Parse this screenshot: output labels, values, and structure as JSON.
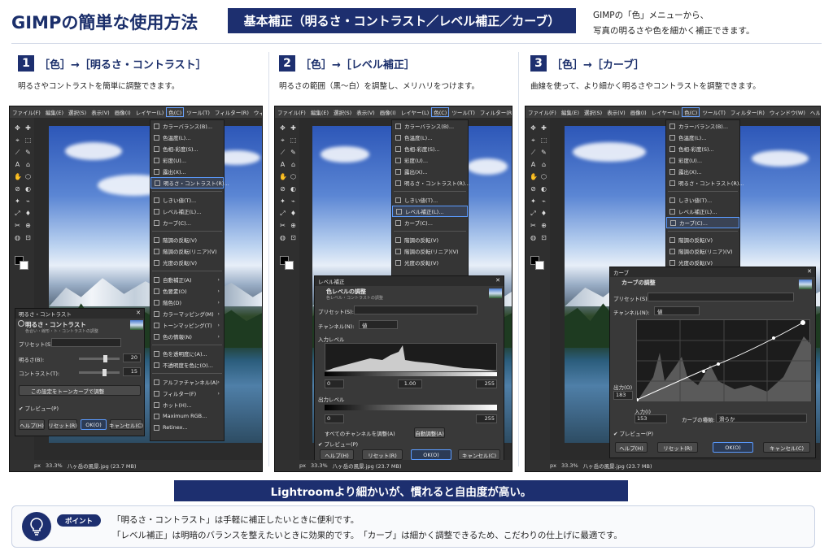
{
  "header": {
    "title": "GIMPの簡単な使用方法",
    "banner": "基本補正（明るさ・コントラスト／レベル補正／カーブ）",
    "lead_line1": "GIMPの「色」メニューから、",
    "lead_line2": "写真の明るさや色を細かく補正できます。"
  },
  "steps": [
    {
      "num": "1",
      "title": "［色］→［明るさ・コントラスト］",
      "desc": "明るさやコントラストを簡単に調整できます。"
    },
    {
      "num": "2",
      "title": "［色］→［レベル補正］",
      "desc": "明るさの範囲（黒〜白）を調整し、メリハリをつけます。"
    },
    {
      "num": "3",
      "title": "［色］→［カーブ］",
      "desc": "曲線を使って、より細かく明るさやコントラストを調整できます。"
    }
  ],
  "menubar": [
    "ファイル(F)",
    "編集(E)",
    "選択(S)",
    "表示(V)",
    "画像(I)",
    "レイヤー(L)",
    "色(C)",
    "ツール(T)",
    "フィルター(R)",
    "ウィンドウ(W)",
    "ヘルプ(H)"
  ],
  "color_menu_full": [
    {
      "label": "カラーバランス(B)..."
    },
    {
      "label": "色温度(L)..."
    },
    {
      "label": "色相-彩度(S)..."
    },
    {
      "label": "彩度(U)..."
    },
    {
      "label": "露出(X)..."
    },
    {
      "label": "明るさ・コントラスト(R)..."
    },
    {
      "sep": true
    },
    {
      "label": "しきい値(T)..."
    },
    {
      "label": "レベル補正(L)..."
    },
    {
      "label": "カーブ(C)..."
    },
    {
      "sep": true
    },
    {
      "label": "階調の反転(V)"
    },
    {
      "label": "階調の反転(リニア)(V)"
    },
    {
      "label": "光度の反転(V)"
    },
    {
      "sep": true
    },
    {
      "label": "自動補正(A)",
      "sub": true
    },
    {
      "label": "色要素(O)",
      "sub": true
    },
    {
      "label": "階色(D)",
      "sub": true
    },
    {
      "label": "カラーマッピング(M)",
      "sub": true
    },
    {
      "label": "トーンマッピング(T)",
      "sub": true
    },
    {
      "label": "色の情報(N)",
      "sub": true
    },
    {
      "sep": true
    },
    {
      "label": "色を透明度に(A)..."
    },
    {
      "label": "不透明度を色に(O)..."
    },
    {
      "sep": true
    },
    {
      "label": "アルファチャンネル(A)",
      "sub": true
    },
    {
      "label": "フィルター(F)",
      "sub": true
    },
    {
      "label": "ホット(H)..."
    },
    {
      "label": "Maximum RGB..."
    },
    {
      "label": "Retinex..."
    }
  ],
  "color_menu_short": [
    "カラーバランス(B)...",
    "色温度(L)...",
    "色相-彩度(S)...",
    "彩度(U)...",
    "露出(X)...",
    "明るさ・コントラスト(R)...",
    "しきい値(T)...",
    "レベル補正(L)...",
    "カーブ(C)...",
    "階調の反転(V)",
    "階調の反転(リニア)(V)",
    "光度の反転(V)"
  ],
  "status": {
    "unit": "px",
    "zoom": "33.3%",
    "file": "八ヶ岳の風景.jpg (23.7 MB)"
  },
  "dialog1": {
    "window_title": "明るさ・コントラスト",
    "heading": "明るさ・コントラスト",
    "subheading": "色合い・線形・ト・コントラストの調整",
    "preset_label": "プリセット(S):",
    "brightness_label": "明るさ(B):",
    "brightness_value": "20",
    "brightness_pct": 0.6,
    "contrast_label": "コントラスト(T):",
    "contrast_value": "15",
    "contrast_pct": 0.57,
    "tone_curve_btn": "この設定をトーンカーブで調整",
    "preview": "プレビュー(P)",
    "help": "ヘルプ(H)",
    "reset": "リセット(R)",
    "ok": "OK(O)",
    "cancel": "キャンセル(C)"
  },
  "dialog2": {
    "window_title": "レベル補正",
    "heading": "色レベルの調整",
    "subheading": "色レベル・コントラストの調整",
    "preset_label": "プリセット(S):",
    "channel_label": "チャンネル(N):",
    "channel_value": "値",
    "input_label": "入力レベル",
    "in_low": "0",
    "in_gamma": "1.00",
    "in_high": "255",
    "output_label": "出力レベル",
    "out_low": "0",
    "out_high": "255",
    "all_channels": "すべてのチャンネルを調整(A)",
    "auto": "自動調整(A)",
    "preview": "プレビュー(P)",
    "help": "ヘルプ(H)",
    "reset": "リセット(R)",
    "ok": "OK(O)",
    "cancel": "キャンセル(C)"
  },
  "dialog3": {
    "window_title": "カーブ",
    "heading": "カーブの調整",
    "preset_label": "プリセット(S):",
    "channel_label": "チャンネル(N):",
    "channel_value": "値",
    "output_label": "出力(O)",
    "output_value": "183",
    "input_label": "入力(I)",
    "input_value": "153",
    "curve_type_label": "カーブの種類:",
    "curve_type_value": "滑らか",
    "preview": "プレビュー(P)",
    "help": "ヘルプ(H)",
    "reset": "リセット(R)",
    "ok": "OK(O)",
    "cancel": "キャンセル(C)"
  },
  "bottom_banner": "Lightroomより細かいが、慣れると自由度が高い。",
  "tip": {
    "pill": "ポイント",
    "line1": "「明るさ・コントラスト」は手軽に補正したいときに便利です。",
    "line2": "「レベル補正」は明暗のバランスを整えたいときに効果的です。　「カーブ」は細かく調整できるため、こだわりの仕上げに最適です。"
  },
  "colors": {
    "navy": "#1d2f6f",
    "highlight": "#5b9bff"
  }
}
